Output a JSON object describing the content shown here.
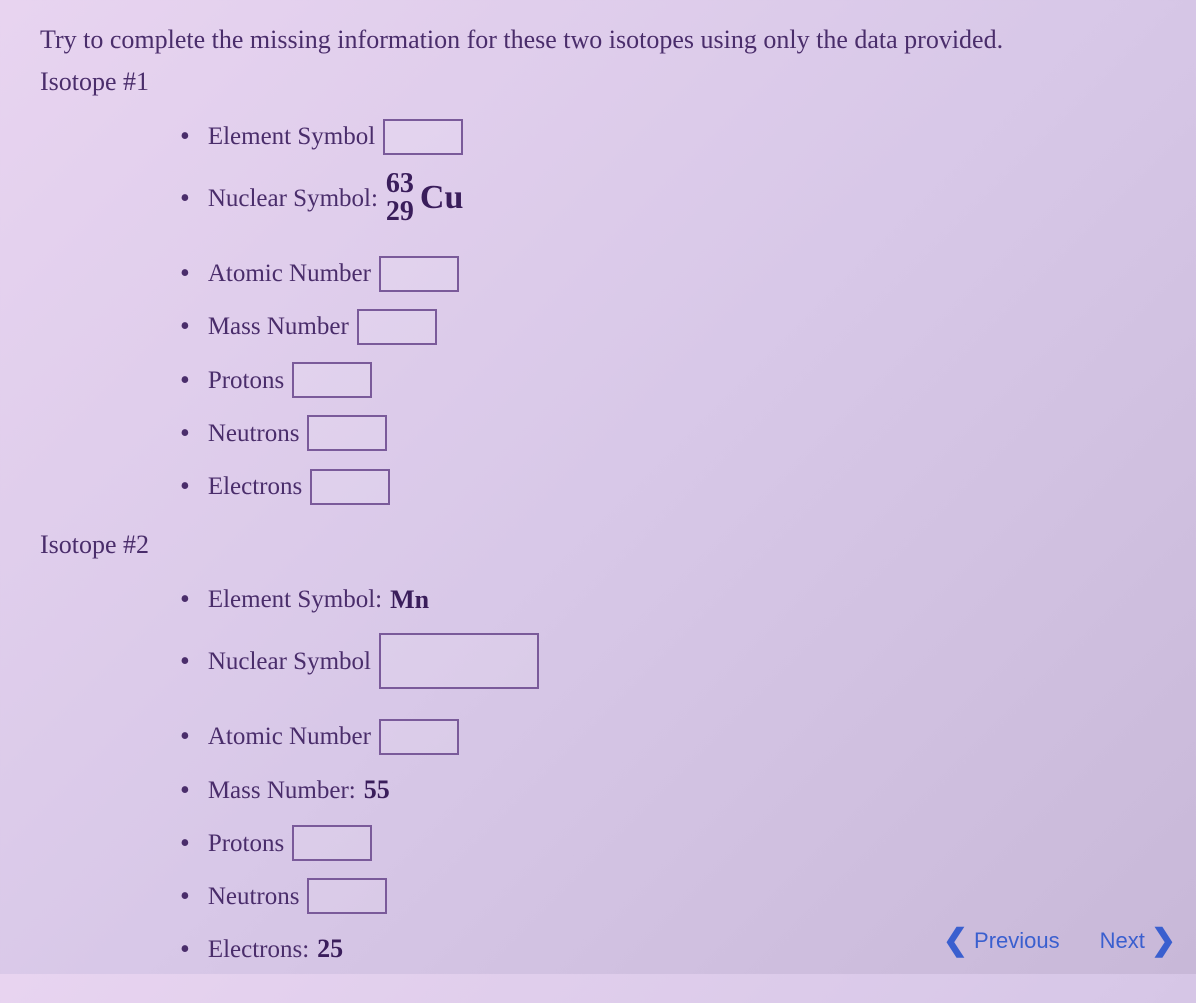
{
  "intro": "Try to complete the missing information for these two isotopes using only the data provided.",
  "iso1": {
    "header": "Isotope #1",
    "elementSymbolLabel": "Element Symbol",
    "nuclearSymbolLabel": "Nuclear Symbol:",
    "nuclear": {
      "top": "63",
      "bottom": "29",
      "sym": "Cu"
    },
    "atomicNumberLabel": "Atomic Number",
    "massNumberLabel": "Mass Number",
    "protonsLabel": "Protons",
    "neutronsLabel": "Neutrons",
    "electronsLabel": "Electrons"
  },
  "iso2": {
    "header": "Isotope #2",
    "elementSymbolLabel": "Element Symbol:",
    "elementSymbolValue": "Mn",
    "nuclearSymbolLabel": "Nuclear Symbol",
    "atomicNumberLabel": "Atomic Number",
    "massNumberLabel": "Mass Number:",
    "massNumberValue": "55",
    "protonsLabel": "Protons",
    "neutronsLabel": "Neutrons",
    "electronsLabel": "Electrons:",
    "electronsValue": "25"
  },
  "nav": {
    "prev": "Previous",
    "next": "Next"
  }
}
